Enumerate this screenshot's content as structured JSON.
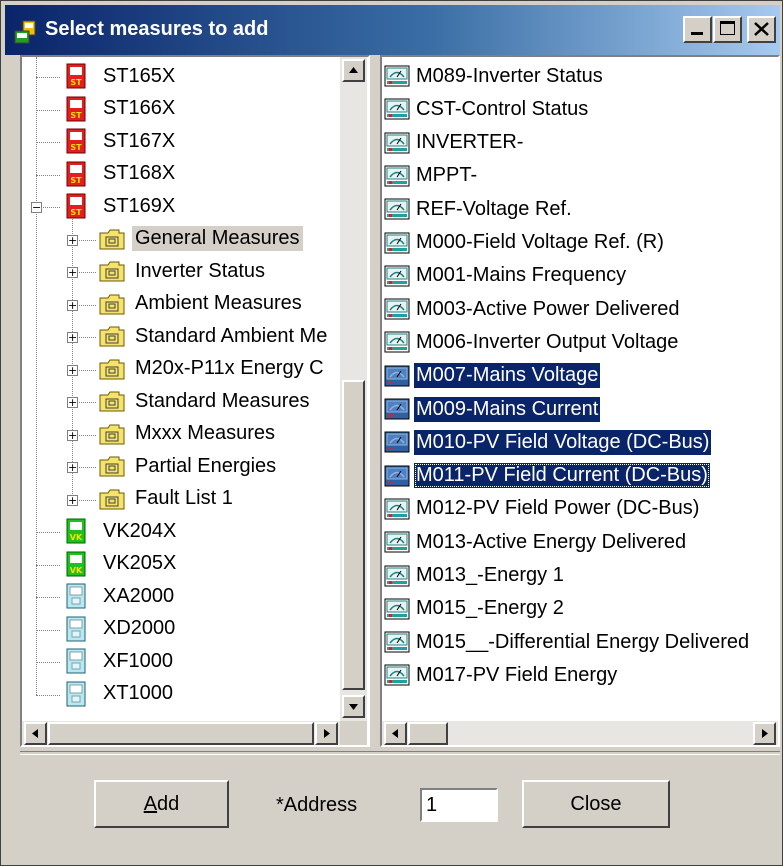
{
  "window": {
    "title": "Select measures to add",
    "minimize_glyph": "_",
    "maximize_glyph": "□",
    "close_glyph": "X"
  },
  "tree": {
    "items": [
      {
        "label": "ST165X",
        "icon": "device-st-icon",
        "expander": ""
      },
      {
        "label": "ST166X",
        "icon": "device-st-icon",
        "expander": ""
      },
      {
        "label": "ST167X",
        "icon": "device-st-icon",
        "expander": ""
      },
      {
        "label": "ST168X",
        "icon": "device-st-icon",
        "expander": ""
      },
      {
        "label": "ST169X",
        "icon": "device-st-icon",
        "expander": "−"
      },
      {
        "label": "General Measures",
        "icon": "folder-icon",
        "expander": "+",
        "selected": true
      },
      {
        "label": "Inverter Status",
        "icon": "folder-icon",
        "expander": "+"
      },
      {
        "label": "Ambient Measures",
        "icon": "folder-icon",
        "expander": "+"
      },
      {
        "label": "Standard Ambient Me",
        "icon": "folder-icon",
        "expander": "+"
      },
      {
        "label": "M20x-P11x Energy C",
        "icon": "folder-icon",
        "expander": "+"
      },
      {
        "label": " Standard Measures",
        "icon": "folder-icon",
        "expander": "+"
      },
      {
        "label": "Mxxx Measures",
        "icon": "folder-icon",
        "expander": "+"
      },
      {
        "label": "Partial Energies",
        "icon": "folder-icon",
        "expander": "+"
      },
      {
        "label": "Fault List 1",
        "icon": "folder-icon",
        "expander": "+"
      },
      {
        "label": "VK204X",
        "icon": "device-vk-icon",
        "expander": ""
      },
      {
        "label": "VK205X",
        "icon": "device-vk-icon",
        "expander": ""
      },
      {
        "label": "XA2000",
        "icon": "device-x-icon",
        "expander": ""
      },
      {
        "label": "XD2000",
        "icon": "device-x-icon",
        "expander": ""
      },
      {
        "label": "XF1000",
        "icon": "device-x-icon",
        "expander": ""
      },
      {
        "label": "XT1000",
        "icon": "device-x-icon",
        "expander": ""
      }
    ],
    "icon_badges": {
      "st": "ST",
      "vk": "VK"
    }
  },
  "measures": {
    "items": [
      {
        "label": "M089-Inverter Status"
      },
      {
        "label": "CST-Control Status"
      },
      {
        "label": "INVERTER-"
      },
      {
        "label": "MPPT-"
      },
      {
        "label": "REF-Voltage Ref."
      },
      {
        "label": "M000-Field Voltage Ref. (R)"
      },
      {
        "label": "M001-Mains Frequency"
      },
      {
        "label": "M003-Active Power Delivered"
      },
      {
        "label": "M006-Inverter Output Voltage"
      },
      {
        "label": "M007-Mains Voltage",
        "selected": true
      },
      {
        "label": "M009-Mains Current",
        "selected": true
      },
      {
        "label": "M010-PV Field Voltage (DC-Bus)",
        "selected": true
      },
      {
        "label": "M011-PV Field Current (DC-Bus)",
        "selected": true,
        "focused": true
      },
      {
        "label": "M012-PV Field Power (DC-Bus)"
      },
      {
        "label": "M013-Active Energy Delivered"
      },
      {
        "label": "M013_-Energy 1"
      },
      {
        "label": "M015_-Energy 2"
      },
      {
        "label": "M015__-Differential Energy Delivered"
      },
      {
        "label": "M017-PV Field Energy"
      }
    ]
  },
  "footer": {
    "add_label": "Add",
    "add_mnemonic": "A",
    "add_rest": "dd",
    "address_label": "*Address",
    "address_value": "1",
    "close_label": "Close"
  },
  "colors": {
    "title_gradient_start": "#0a246a",
    "selection": "#0a246a",
    "face": "#d4d0c8"
  }
}
